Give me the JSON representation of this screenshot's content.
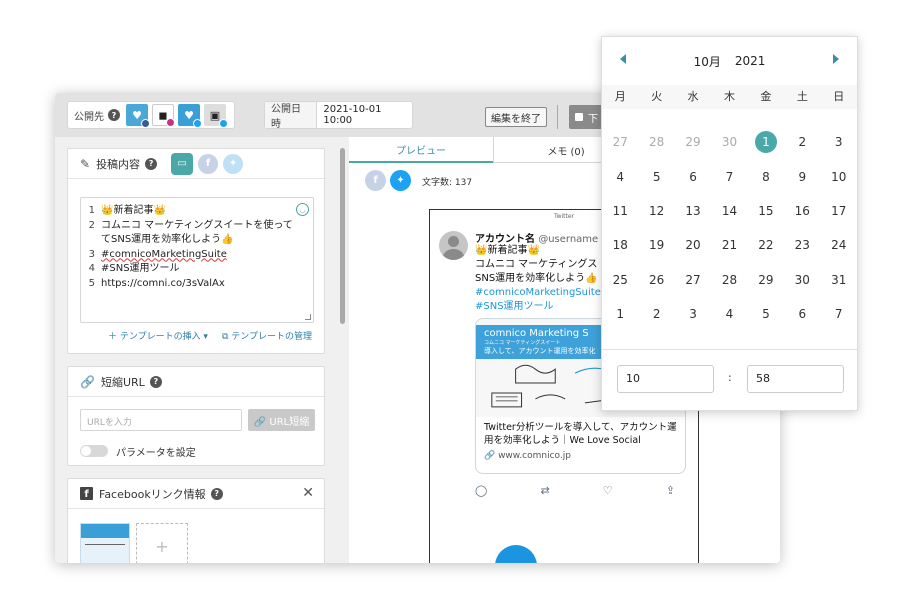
{
  "topbar": {
    "publish_to_label": "公開先",
    "help": "?",
    "accounts": [
      {
        "name": "account-1",
        "network": "facebook"
      },
      {
        "name": "account-2",
        "network": "instagram"
      },
      {
        "name": "account-3",
        "network": "twitter"
      },
      {
        "name": "account-4",
        "network": "twitter"
      }
    ],
    "publish_date_label": "公開日時",
    "publish_date_value": "2021-10-01 10:00",
    "end_edit_label": "編集を終了",
    "save_label": "下"
  },
  "post_card": {
    "title": "投稿内容",
    "help": "?",
    "lines": [
      {
        "n": "1",
        "text": "👑新着記事👑"
      },
      {
        "n": "2",
        "text": "コムニコ マーケティングスイートを使って"
      },
      {
        "n": "",
        "text": "てSNS運用を効率化しよう👍"
      },
      {
        "n": "3",
        "text": "#comnicoMarketingSuite"
      },
      {
        "n": "4",
        "text": "#SNS運用ツール"
      },
      {
        "n": "5",
        "text": "https://comni.co/3sValAx"
      }
    ],
    "insert_template": "＋ テンプレートの挿入 ▾",
    "manage_template": "⧉ テンプレートの管理"
  },
  "short_url_card": {
    "title": "短縮URL",
    "help": "?",
    "url_placeholder": "URLを入力",
    "shorten_button": "🔗 URL短縮",
    "param_toggle_label": "パラメータを設定"
  },
  "fb_card": {
    "title": "Facebookリンク情報",
    "help": "?",
    "add_label": "+"
  },
  "preview": {
    "tabs": [
      {
        "label": "プレビュー",
        "active": true
      },
      {
        "label": "メモ (0)",
        "active": false
      }
    ],
    "char_count": "文字数: 137",
    "phone_top": "Twitter",
    "tweet": {
      "account_name": "アカウント名",
      "username": "@username",
      "line1": "👑新着記事👑",
      "line2": "コムニコ マーケティングス",
      "line3": "SNS運用を効率化しよう👍",
      "hash1": "#comnicoMarketingSuite",
      "hash2": "#SNS運用ツール",
      "card_banner_title": "comnico Marketing S",
      "card_banner_sub": "コムニコ マーケティングスイート",
      "card_banner_text": "導入して、アカウント運用を効率化",
      "card_text": "Twitter分析ツールを導入して、アカウント運用を効率化しよう｜We Love Social",
      "card_url": "🔗 www.comnico.jp"
    }
  },
  "datepicker": {
    "month": "10月",
    "year": "2021",
    "weekdays": [
      "月",
      "火",
      "水",
      "木",
      "金",
      "土",
      "日"
    ],
    "weeks": [
      [
        {
          "d": "27",
          "m": true
        },
        {
          "d": "28",
          "m": true
        },
        {
          "d": "29",
          "m": true
        },
        {
          "d": "30",
          "m": true
        },
        {
          "d": "1",
          "sel": true
        },
        {
          "d": "2"
        },
        {
          "d": "3"
        }
      ],
      [
        {
          "d": "4"
        },
        {
          "d": "5"
        },
        {
          "d": "6"
        },
        {
          "d": "7"
        },
        {
          "d": "8"
        },
        {
          "d": "9"
        },
        {
          "d": "10"
        }
      ],
      [
        {
          "d": "11"
        },
        {
          "d": "12"
        },
        {
          "d": "13"
        },
        {
          "d": "14"
        },
        {
          "d": "15"
        },
        {
          "d": "16"
        },
        {
          "d": "17"
        }
      ],
      [
        {
          "d": "18"
        },
        {
          "d": "19"
        },
        {
          "d": "20"
        },
        {
          "d": "21"
        },
        {
          "d": "22"
        },
        {
          "d": "23"
        },
        {
          "d": "24"
        }
      ],
      [
        {
          "d": "25"
        },
        {
          "d": "26"
        },
        {
          "d": "27"
        },
        {
          "d": "28"
        },
        {
          "d": "29"
        },
        {
          "d": "30"
        },
        {
          "d": "31"
        }
      ],
      [
        {
          "d": "1"
        },
        {
          "d": "2"
        },
        {
          "d": "3"
        },
        {
          "d": "4"
        },
        {
          "d": "5"
        },
        {
          "d": "6"
        },
        {
          "d": "7"
        }
      ]
    ],
    "hour": "10",
    "minute": "58",
    "colon": ":"
  },
  "colors": {
    "accent": "#4aa8a8",
    "twitter": "#1da1f2",
    "link": "#2c7fa8"
  }
}
